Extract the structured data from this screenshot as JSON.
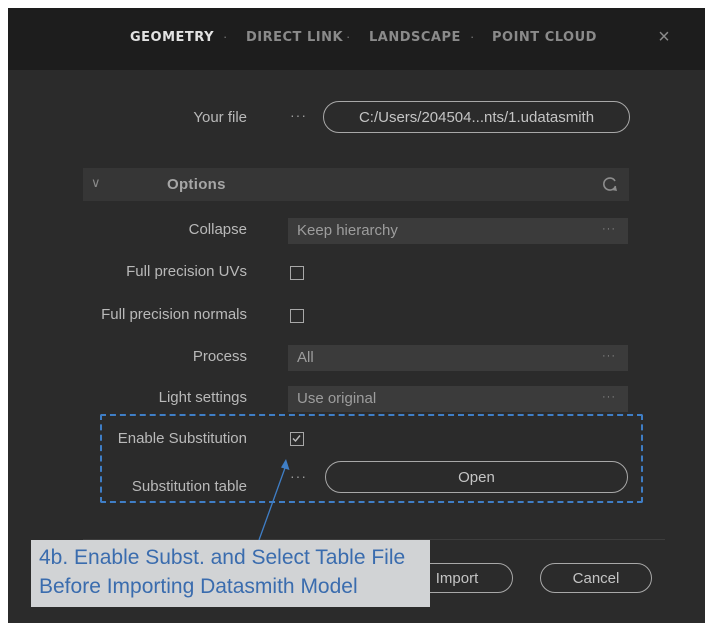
{
  "tabs": [
    {
      "label": "GEOMETRY",
      "active": true
    },
    {
      "label": "DIRECT LINK",
      "active": false
    },
    {
      "label": "LANDSCAPE",
      "active": false
    },
    {
      "label": "POINT CLOUD",
      "active": false
    }
  ],
  "tab_separator": "·",
  "close_icon": "×",
  "file": {
    "label": "Your file",
    "more": "···",
    "path": "C:/Users/204504...nts/1.udatasmith"
  },
  "options": {
    "chevron": "∨",
    "title": "Options",
    "collapse": {
      "label": "Collapse",
      "value": "Keep hierarchy",
      "more": "···"
    },
    "full_precision_uvs": {
      "label": "Full precision UVs",
      "checked": false
    },
    "full_precision_normals": {
      "label": "Full precision normals",
      "checked": false
    },
    "process": {
      "label": "Process",
      "value": "All",
      "more": "···"
    },
    "light_settings": {
      "label": "Light settings",
      "value": "Use original",
      "more": "···"
    },
    "enable_substitution": {
      "label": "Enable Substitution",
      "checked": true
    },
    "substitution_table": {
      "label": "Substitution table",
      "more": "···",
      "button": "Open"
    }
  },
  "footer": {
    "import": "Import",
    "cancel": "Cancel"
  },
  "annotation": {
    "line1": "4b. Enable Subst. and Select Table File",
    "line2": "Before Importing Datasmith Model",
    "color": "#3a6cae",
    "highlight_color": "#3f7ec6"
  }
}
